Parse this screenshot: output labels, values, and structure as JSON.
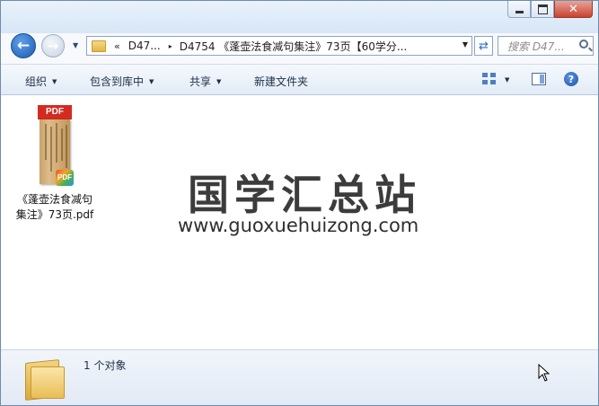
{
  "window": {
    "caption_buttons": {
      "minimize": "minimize",
      "maximize": "maximize",
      "close": "✕"
    }
  },
  "nav": {
    "back_icon": "back-arrow-icon",
    "forward_icon": "forward-arrow-icon",
    "address": {
      "overflow": "«",
      "crumb1": "D47...",
      "separator": "▸",
      "current": "D4754 《蓬壶法食减句集注》73页【60学分..."
    },
    "search_placeholder": "搜索 D47..."
  },
  "toolbar": {
    "organize": "组织",
    "include_library": "包含到库中",
    "share": "共享",
    "new_folder": "新建文件夹"
  },
  "files": [
    {
      "name": "《蓬壶法食减句集注》73页.pdf",
      "name_line1": "《蓬壶法食减句",
      "name_line2": "集注》73页.pdf",
      "thumb_label": "PDF",
      "badge_label": "PDF",
      "type": "pdf"
    }
  ],
  "watermark": {
    "title": "国学汇总站",
    "url": "www.guoxuehuizong.com"
  },
  "status": {
    "text": "1 个对象"
  },
  "colors": {
    "window_border": "#6f8caa",
    "toolbar_bg": "#e2ebf6",
    "pdf_red": "#d32b20",
    "back_button_blue": "#1d5aad"
  }
}
